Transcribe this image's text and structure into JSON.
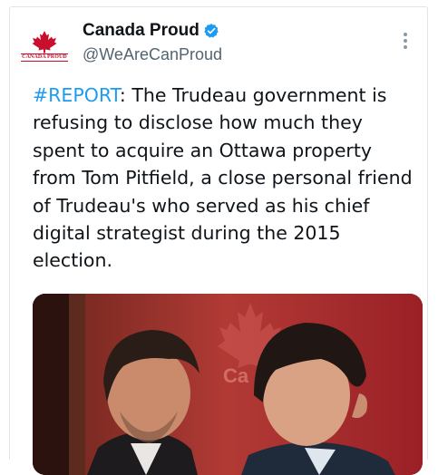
{
  "author": {
    "display_name": "Canada Proud",
    "handle": "@WeAreCanProud",
    "avatar_label": "CANADA PROUD",
    "verified": true,
    "verified_color": "#1d9bf0"
  },
  "tweet": {
    "hashtag": "#REPORT",
    "body": ": The Trudeau government is refusing to disclose how much they spent to acquire an Ottawa property from Tom Pitfield, a close personal friend of Trudeau's who served as his chief digital strategist during the 2015 election."
  },
  "media": {
    "backdrop_text": "Ca"
  },
  "colors": {
    "link": "#1d9bf0",
    "text": "#0f1419",
    "secondary": "#536471",
    "brand_red": "#c8102e"
  }
}
